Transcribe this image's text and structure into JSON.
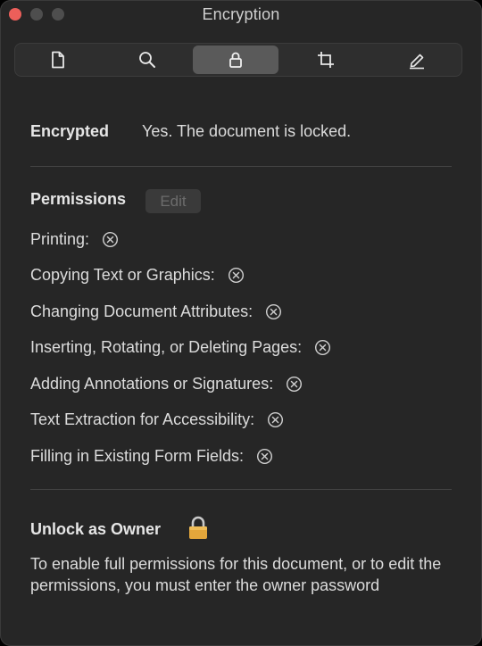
{
  "window": {
    "title": "Encryption"
  },
  "toolbar": {
    "tabs": [
      {
        "icon": "document-icon",
        "active": false
      },
      {
        "icon": "search-icon",
        "active": false
      },
      {
        "icon": "lock-icon",
        "active": true
      },
      {
        "icon": "crop-icon",
        "active": false
      },
      {
        "icon": "pencil-icon",
        "active": false
      }
    ]
  },
  "encryption": {
    "label": "Encrypted",
    "value": "Yes. The document is locked."
  },
  "permissions": {
    "title": "Permissions",
    "edit_label": "Edit",
    "items": [
      {
        "label": "Printing:",
        "allowed": false
      },
      {
        "label": "Copying Text or Graphics:",
        "allowed": false
      },
      {
        "label": "Changing Document Attributes:",
        "allowed": false
      },
      {
        "label": "Inserting, Rotating, or Deleting Pages:",
        "allowed": false
      },
      {
        "label": "Adding Annotations or Signatures:",
        "allowed": false
      },
      {
        "label": "Text Extraction for Accessibility:",
        "allowed": false
      },
      {
        "label": "Filling in Existing Form Fields:",
        "allowed": false
      }
    ]
  },
  "unlock": {
    "title": "Unlock as Owner",
    "description": "To enable full permissions for this document, or to edit the permissions, you must enter the owner password"
  },
  "colors": {
    "background": "#262626",
    "close_button": "#ec5f5a",
    "lock_gold": "#e3a63b"
  }
}
